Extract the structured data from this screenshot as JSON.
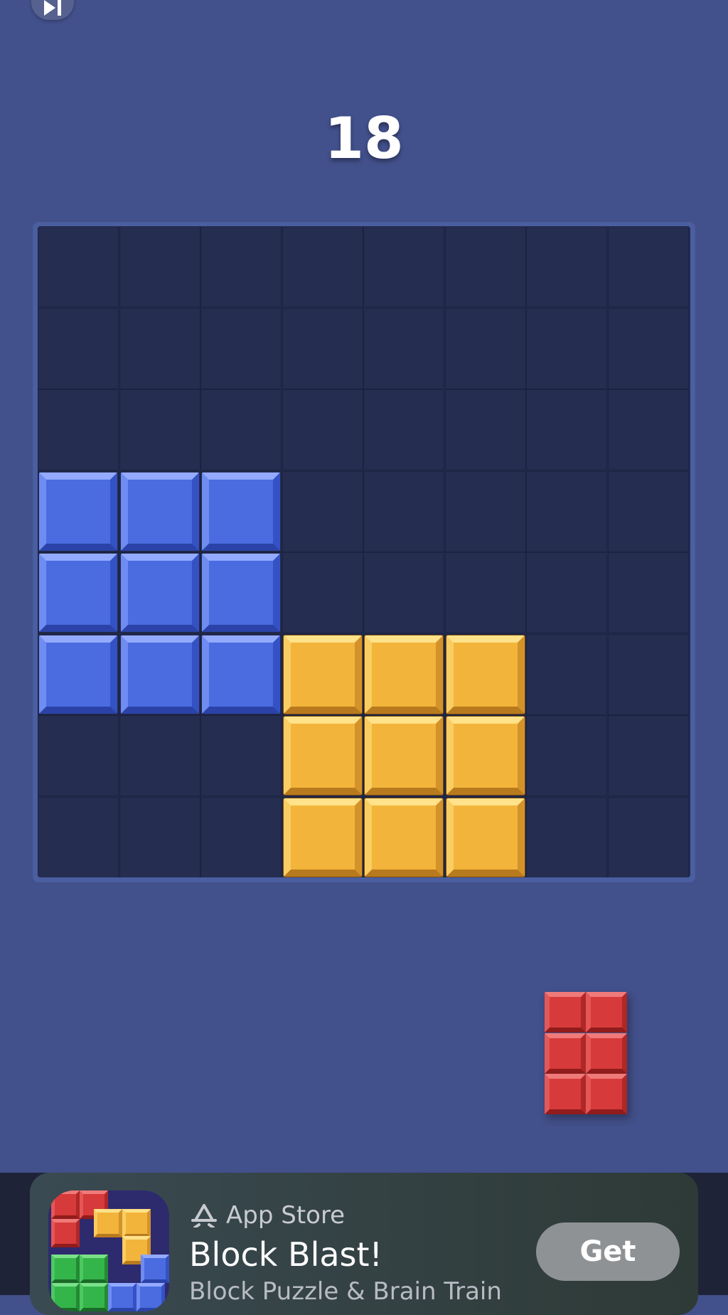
{
  "score": "18",
  "board": {
    "rows": 8,
    "cols": 8,
    "blocks": [
      {
        "row": 3,
        "col": 0,
        "color": "blue"
      },
      {
        "row": 3,
        "col": 1,
        "color": "blue"
      },
      {
        "row": 3,
        "col": 2,
        "color": "blue"
      },
      {
        "row": 4,
        "col": 0,
        "color": "blue"
      },
      {
        "row": 4,
        "col": 1,
        "color": "blue"
      },
      {
        "row": 4,
        "col": 2,
        "color": "blue"
      },
      {
        "row": 5,
        "col": 0,
        "color": "blue"
      },
      {
        "row": 5,
        "col": 1,
        "color": "blue"
      },
      {
        "row": 5,
        "col": 2,
        "color": "blue"
      },
      {
        "row": 5,
        "col": 3,
        "color": "yellow"
      },
      {
        "row": 5,
        "col": 4,
        "color": "yellow"
      },
      {
        "row": 5,
        "col": 5,
        "color": "yellow"
      },
      {
        "row": 6,
        "col": 3,
        "color": "yellow"
      },
      {
        "row": 6,
        "col": 4,
        "color": "yellow"
      },
      {
        "row": 6,
        "col": 5,
        "color": "yellow"
      },
      {
        "row": 7,
        "col": 3,
        "color": "yellow"
      },
      {
        "row": 7,
        "col": 4,
        "color": "yellow"
      },
      {
        "row": 7,
        "col": 5,
        "color": "yellow"
      }
    ]
  },
  "tray": {
    "piece": {
      "rows": 3,
      "cols": 2,
      "color": "red"
    }
  },
  "colors": {
    "background": "#42508b",
    "board": "#232b4d",
    "blue": "#4a6ce0",
    "yellow": "#f2b43a",
    "red": "#d73a3a"
  },
  "ad": {
    "store_label": "App Store",
    "app_name": "Block Blast!",
    "subtitle": "Block Puzzle & Brain Train",
    "button_label": "Get",
    "icons": [
      "skip-icon",
      "app-store-icon",
      "app-icon"
    ]
  }
}
